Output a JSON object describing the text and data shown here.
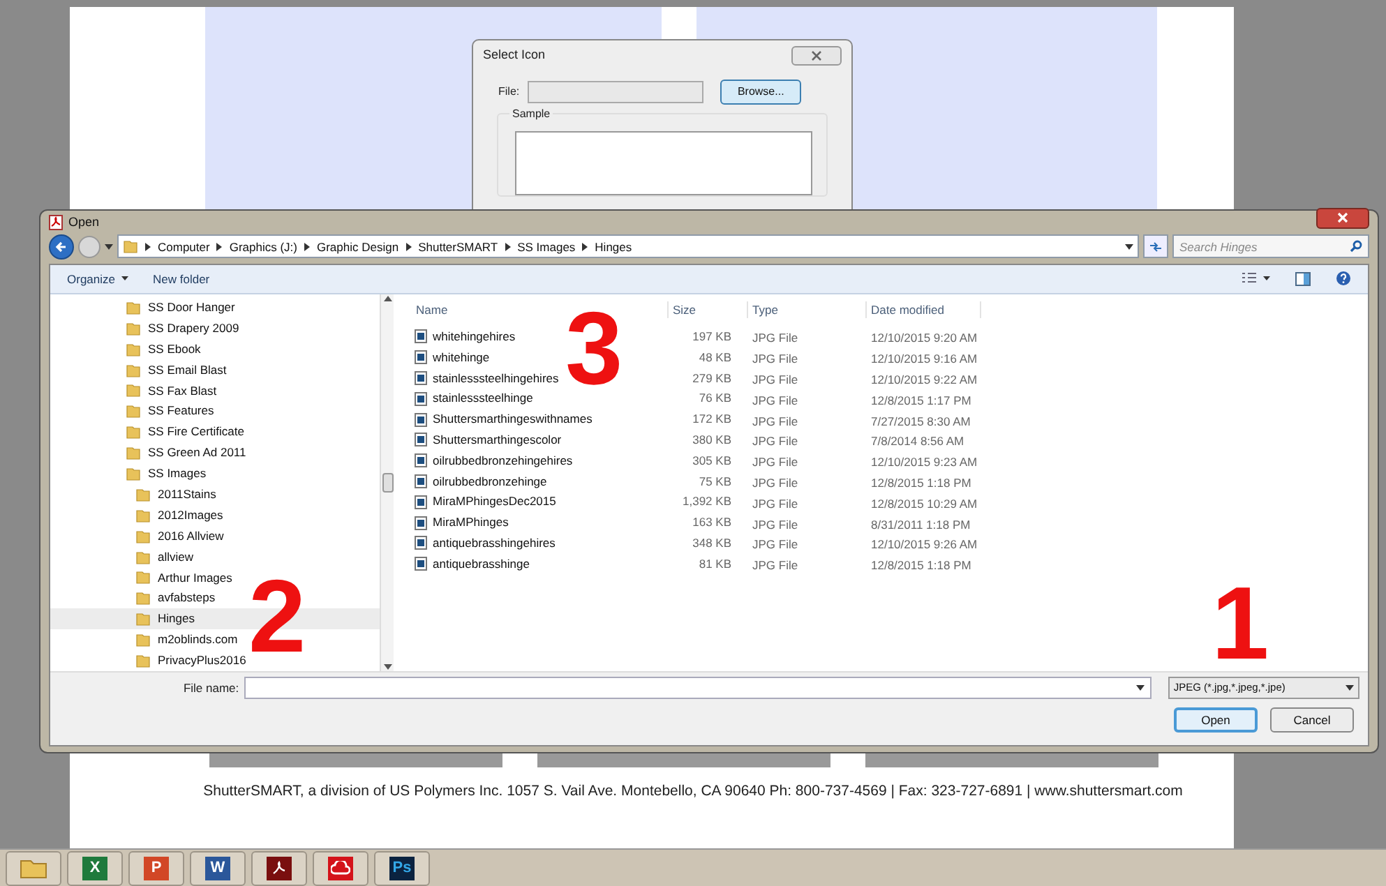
{
  "background_dialog": {
    "title": "Select Icon",
    "file_label": "File:",
    "browse_button": "Browse...",
    "sample_label": "Sample"
  },
  "window": {
    "title": "Open"
  },
  "address_bar": {
    "crumbs": [
      "Computer",
      "Graphics (J:)",
      "Graphic Design",
      "ShutterSMART",
      "SS Images",
      "Hinges"
    ]
  },
  "search": {
    "placeholder": "Search Hinges"
  },
  "toolbar": {
    "buttons": [
      "Organize",
      "New folder"
    ]
  },
  "tree": [
    {
      "label": "SS Door Hanger",
      "selected": false
    },
    {
      "label": "SS Drapery 2009",
      "selected": false
    },
    {
      "label": "SS Ebook",
      "selected": false
    },
    {
      "label": "SS Email Blast",
      "selected": false
    },
    {
      "label": "SS Fax Blast",
      "selected": false
    },
    {
      "label": "SS Features",
      "selected": false
    },
    {
      "label": "SS Fire Certificate",
      "selected": false
    },
    {
      "label": "SS Green Ad 2011",
      "selected": false
    },
    {
      "label": "SS Images",
      "selected": false,
      "children": [
        {
          "label": "2011Stains",
          "selected": false
        },
        {
          "label": "2012Images",
          "selected": false
        },
        {
          "label": "2016 Allview",
          "selected": false
        },
        {
          "label": "allview",
          "selected": false
        },
        {
          "label": "Arthur Images",
          "selected": false
        },
        {
          "label": "avfabsteps",
          "selected": false
        },
        {
          "label": "Hinges",
          "selected": true
        },
        {
          "label": "m2oblinds.com",
          "selected": false
        },
        {
          "label": "PrivacyPlus2016",
          "selected": false
        }
      ]
    }
  ],
  "table": {
    "columns": [
      "Name",
      "Size",
      "Type",
      "Date modified"
    ],
    "rows": [
      {
        "name": "whitehingehires",
        "size": "197 KB",
        "type": "JPG File",
        "date": "12/10/2015 9:20 AM"
      },
      {
        "name": "whitehinge",
        "size": "48 KB",
        "type": "JPG File",
        "date": "12/10/2015 9:16 AM"
      },
      {
        "name": "stainlesssteelhingehires",
        "size": "279 KB",
        "type": "JPG File",
        "date": "12/10/2015 9:22 AM"
      },
      {
        "name": "stainlesssteelhinge",
        "size": "76 KB",
        "type": "JPG File",
        "date": "12/8/2015 1:17 PM"
      },
      {
        "name": "Shuttersmarthingeswithnames",
        "size": "172 KB",
        "type": "JPG File",
        "date": "7/27/2015 8:30 AM"
      },
      {
        "name": "Shuttersmarthingescolor",
        "size": "380 KB",
        "type": "JPG File",
        "date": "7/8/2014 8:56 AM"
      },
      {
        "name": "oilrubbedbronzehingehires",
        "size": "305 KB",
        "type": "JPG File",
        "date": "12/10/2015 9:23 AM"
      },
      {
        "name": "oilrubbedbronzehinge",
        "size": "75 KB",
        "type": "JPG File",
        "date": "12/8/2015 1:18 PM"
      },
      {
        "name": "MiraMPhingesDec2015",
        "size": "1,392 KB",
        "type": "JPG File",
        "date": "12/8/2015 10:29 AM"
      },
      {
        "name": "MiraMPhinges",
        "size": "163 KB",
        "type": "JPG File",
        "date": "8/31/2011 1:18 PM"
      },
      {
        "name": "antiquebrasshingehires",
        "size": "348 KB",
        "type": "JPG File",
        "date": "12/10/2015 9:26 AM"
      },
      {
        "name": "antiquebrasshinge",
        "size": "81 KB",
        "type": "JPG File",
        "date": "12/8/2015 1:18 PM"
      }
    ]
  },
  "file_name": {
    "label": "File name:"
  },
  "file_type": {
    "value": "JPEG (*.jpg,*.jpeg,*.jpe)"
  },
  "buttons": [
    {
      "label": "Open",
      "default": true
    },
    {
      "label": "Cancel",
      "default": false
    }
  ],
  "annotations": [
    "1",
    "2",
    "3"
  ],
  "footer": "ShutterSMART, a division of US Polymers Inc. 1057 S. Vail Ave. Montebello, CA 90640 Ph: 800-737-4569 | Fax: 323-727-6891 | www.shuttersmart.com",
  "taskbar": [
    {
      "kind": "explorer"
    },
    {
      "kind": "excel",
      "label": "X"
    },
    {
      "kind": "powerpoint",
      "label": "P"
    },
    {
      "kind": "word",
      "label": "W"
    },
    {
      "kind": "acrobat"
    },
    {
      "kind": "cloud"
    },
    {
      "kind": "photoshop",
      "label": "Ps"
    }
  ]
}
